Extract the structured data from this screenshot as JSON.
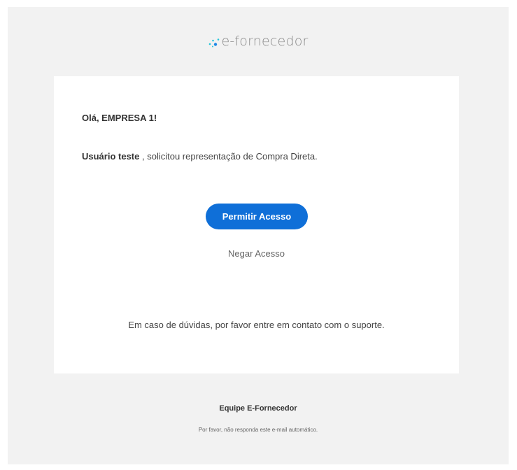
{
  "brand": {
    "logo_icon": "dots-logo-icon",
    "logo_text": "e-fornecedor",
    "colors": {
      "primary": "#0f6fd8",
      "logo_dot_blue": "#1e88e5",
      "logo_dot_teal": "#26c6da",
      "background": "#f2f2f2",
      "card": "#ffffff"
    }
  },
  "message": {
    "greeting": "Olá, EMPRESA 1!",
    "requester": "Usuário teste",
    "request_text": " , solicitou representação de Compra Direta."
  },
  "actions": {
    "allow_label": "Permitir Acesso",
    "deny_label": "Negar Acesso"
  },
  "support": {
    "text": "Em caso de dúvidas, por favor entre em contato com o suporte."
  },
  "footer": {
    "team": "Equipe E-Fornecedor",
    "note": "Por favor, não responda este e-mail automático."
  }
}
